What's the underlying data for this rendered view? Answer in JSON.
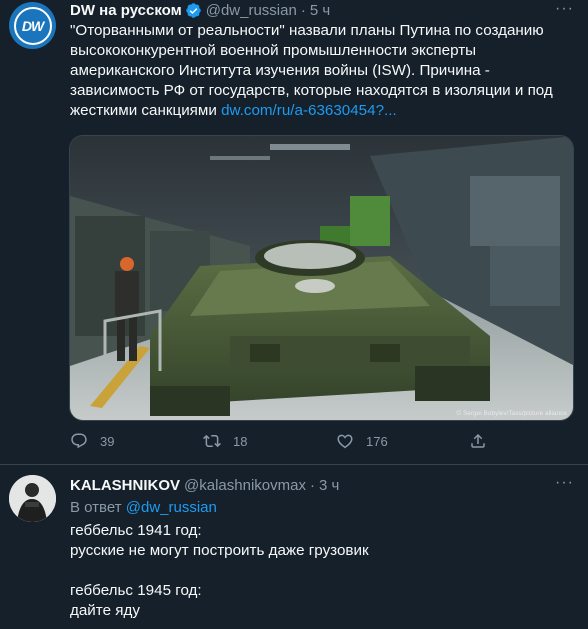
{
  "tweet1": {
    "author_name": "DW на русском",
    "avatar_text": "DW",
    "handle": "@dw_russian",
    "separator": "·",
    "time": "5 ч",
    "more": "···",
    "text": "\"Оторванными от реальности\" назвали планы Путина по созданию высококонкурентной военной промышленности эксперты американского Института изучения войны (ISW). Причина - зависимость РФ от государств, которые находятся в изоляции и под жесткими санкциями ",
    "link": "dw.com/ru/a-63630454?...",
    "photo_credit": "© Sergei Bobylev/Tass/picture alliance",
    "replies": "39",
    "retweets": "18",
    "likes": "176",
    "icons": [
      "reply-icon",
      "retweet-icon",
      "like-icon",
      "share-icon"
    ],
    "verified_color": "#1d9bf0"
  },
  "tweet2": {
    "author_name": "KALASHNIKOV",
    "handle": "@kalashnikovmax",
    "separator": "·",
    "time": "3 ч",
    "more": "···",
    "reply_prefix": "В ответ ",
    "reply_handle": "@dw_russian",
    "lines": [
      "геббельс 1941 год:",
      "русские не могут построить даже грузовик",
      "",
      "геббельс 1945 год:",
      "дайте яду"
    ]
  },
  "colors": {
    "background": "#15202b",
    "text": "#f7f9f9",
    "muted": "#8b98a5",
    "accent": "#1d9bf0",
    "divider": "#38444d"
  }
}
